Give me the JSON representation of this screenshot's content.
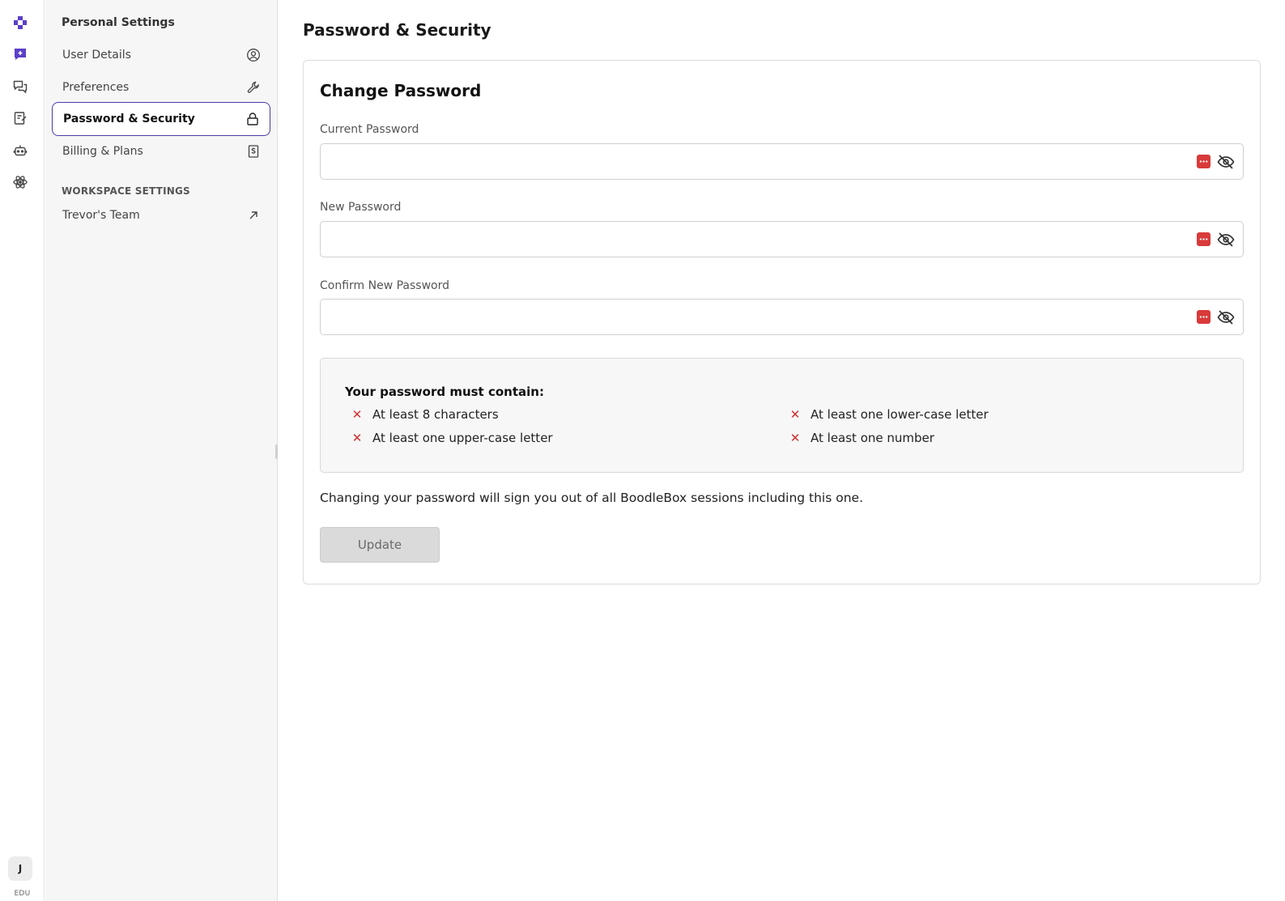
{
  "rail": {
    "icons": [
      "logo-icon",
      "new-chat-icon",
      "chats-icon",
      "notes-icon",
      "bot-icon",
      "atom-icon"
    ],
    "avatar_initial": "J",
    "plan_badge": "EDU"
  },
  "sidebar": {
    "heading": "Personal Settings",
    "items": [
      {
        "label": "User Details",
        "icon": "user-circle-icon"
      },
      {
        "label": "Preferences",
        "icon": "wrench-icon"
      },
      {
        "label": "Password & Security",
        "icon": "lock-icon",
        "active": true
      },
      {
        "label": "Billing & Plans",
        "icon": "receipt-icon"
      }
    ],
    "workspace_heading": "WORKSPACE SETTINGS",
    "workspace_item": {
      "label": "Trevor's Team",
      "icon": "arrow-up-right-icon"
    }
  },
  "main": {
    "page_title": "Password & Security",
    "card_title": "Change Password",
    "fields": [
      {
        "label": "Current Password",
        "value": ""
      },
      {
        "label": "New Password",
        "value": ""
      },
      {
        "label": "Confirm New Password",
        "value": ""
      }
    ],
    "requirements": {
      "heading": "Your password must contain:",
      "items": [
        "At least 8 characters",
        "At least one lower-case letter",
        "At least one upper-case letter",
        "At least one number"
      ]
    },
    "notice": "Changing your password will sign you out of all BoodleBox sessions including this one.",
    "update_label": "Update"
  },
  "colors": {
    "accent": "#5b3fc8",
    "active_border": "#4b3aa8",
    "error": "#d22f2f",
    "password_manager": "#d93a3a"
  }
}
